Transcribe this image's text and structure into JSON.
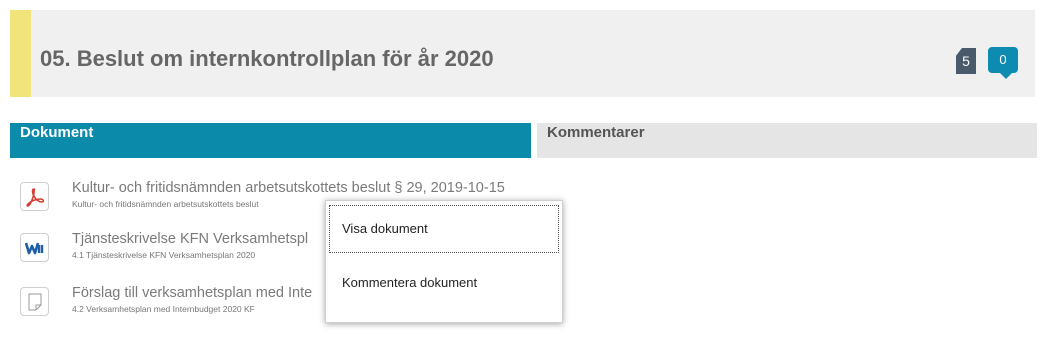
{
  "agenda": {
    "title": "05. Beslut om internkontrollplan för år 2020",
    "documents_count": "5",
    "comments_count": "0"
  },
  "tabs": [
    {
      "label": "Dokument",
      "active": true
    },
    {
      "label": "Kommentarer",
      "active": false
    }
  ],
  "documents": [
    {
      "icon": "pdf-icon",
      "title": "Kultur- och fritidsnämnden arbetsutskottets beslut § 29, 2019-10-15",
      "subtitle": "Kultur- och fritidsnämnden arbetsutskottets beslut"
    },
    {
      "icon": "word-icon",
      "title": "Tjänsteskrivelse KFN Verksamhetspl",
      "subtitle": "4.1 Tjänsteskrivelse KFN Verksamhetsplan 2020"
    },
    {
      "icon": "generic-document-icon",
      "title": "Förslag till verksamhetsplan med Inte",
      "subtitle": "4.2 Verksamhetsplan med Internbudget 2020 KF"
    }
  ],
  "context_menu": {
    "items": [
      {
        "label": "Visa dokument"
      },
      {
        "label": "Kommentera dokument"
      }
    ]
  },
  "colors": {
    "accent": "#f1e47a",
    "active_tab": "#0b8aaa",
    "comment_badge": "#0e8bb1",
    "document_badge": "#4a5a6a"
  }
}
